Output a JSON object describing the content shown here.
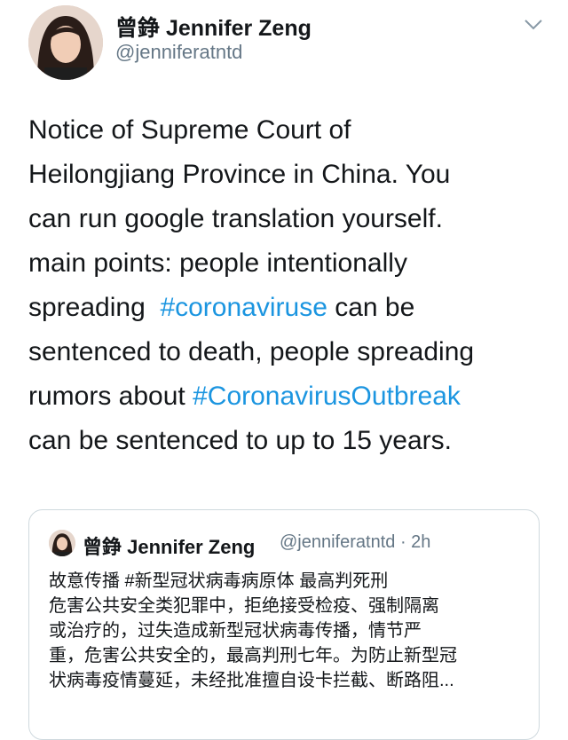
{
  "author": {
    "display_name": "曾錚 Jennifer Zeng",
    "handle": "@jenniferatntd"
  },
  "tweet": {
    "lines": [
      {
        "before": "Notice of Supreme Court of",
        "hashtag": "",
        "after": ""
      },
      {
        "before": "Heilongjiang Province in China. You",
        "hashtag": "",
        "after": ""
      },
      {
        "before": "can run google translation yourself.",
        "hashtag": "",
        "after": ""
      },
      {
        "before": "main points: people intentionally",
        "hashtag": "",
        "after": ""
      },
      {
        "before": "spreading  ",
        "hashtag": "#coronaviruse",
        "after": " can be"
      },
      {
        "before": "sentenced to death, people spreading",
        "hashtag": "",
        "after": ""
      },
      {
        "before": "rumors about ",
        "hashtag": "#CoronavirusOutbreak",
        "after": ""
      },
      {
        "before": "can be sentenced to up to 15 years.",
        "hashtag": "",
        "after": ""
      }
    ]
  },
  "quoted_tweet": {
    "display_name": "曾錚 Jennifer Zeng",
    "meta": "@jenniferatntd · 2h",
    "lines": [
      "故意传播 #新型冠状病毒病原体 最高判死刑",
      "危害公共安全类犯罪中，拒绝接受检疫、强制隔离",
      "或治疗的，过失造成新型冠状病毒传播，情节严",
      "重，危害公共安全的，最高判刑七年。为防止新型冠",
      "状病毒疫情蔓延，未经批准擅自设卡拦截、断路阻..."
    ]
  },
  "icons": {
    "menu": "chevron-down-icon",
    "avatar": "avatar-photo"
  },
  "colors": {
    "hashtag": "#1b95e0",
    "secondary_text": "#657786",
    "border": "#cfd9de"
  }
}
